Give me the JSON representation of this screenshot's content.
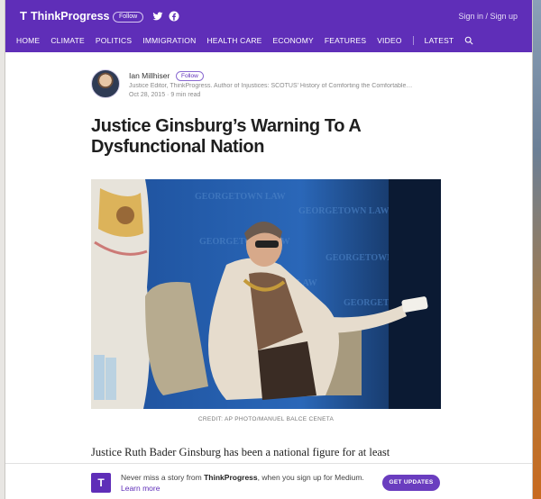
{
  "header": {
    "brand": "ThinkProgress",
    "follow_label": "Follow",
    "signin": "Sign in / Sign up",
    "nav": [
      "HOME",
      "CLIMATE",
      "POLITICS",
      "IMMIGRATION",
      "HEALTH CARE",
      "ECONOMY",
      "FEATURES",
      "VIDEO"
    ],
    "nav_after_sep": "LATEST",
    "icons": [
      "twitter-icon",
      "facebook-icon",
      "search-icon"
    ]
  },
  "author": {
    "name": "Ian Millhiser",
    "follow_label": "Follow",
    "bio": "Justice Editor, ThinkProgress. Author of Injustices: SCOTUS' History of Comforting the Comfortable…",
    "date": "Oct 28, 2015",
    "read_time": "9 min read"
  },
  "article": {
    "title": "Justice Ginsburg’s Warning To A Dysfunctional Nation",
    "photo_credit": "CREDIT: AP PHOTO/MANUEL BALCE CENETA",
    "body_start": "Justice Ruth Bader Ginsburg has been a national figure for at least half of"
  },
  "banner": {
    "text_pre": "Never miss a story from ",
    "publication": "ThinkProgress",
    "text_post": ", when you sign up for Medium. ",
    "learn_more": "Learn more",
    "button": "GET UPDATES"
  },
  "colors": {
    "brand_purple": "#5f2eb8",
    "banner_button": "#6a3dbf"
  }
}
